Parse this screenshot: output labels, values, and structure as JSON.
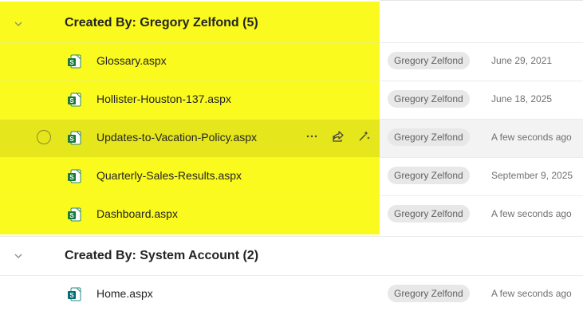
{
  "colors": {
    "highlight": "#fafa1e",
    "highlight_hover": "#e6e61c",
    "sharepoint_icon": "#036c70",
    "pill_bg": "#e8e8e8"
  },
  "groups": [
    {
      "title": "Created By: Gregory Zelfond (5)",
      "icon": "chevron-down-icon",
      "rows": [
        {
          "name": "Glossary.aspx",
          "modified_by": "Gregory Zelfond",
          "date": "June 29, 2021"
        },
        {
          "name": "Hollister-Houston-137.aspx",
          "modified_by": "Gregory Zelfond",
          "date": "June 18, 2025"
        },
        {
          "name": "Updates-to-Vacation-Policy.aspx",
          "modified_by": "Gregory Zelfond",
          "date": "A few seconds ago"
        },
        {
          "name": "Quarterly-Sales-Results.aspx",
          "modified_by": "Gregory Zelfond",
          "date": "September 9, 2025"
        },
        {
          "name": "Dashboard.aspx",
          "modified_by": "Gregory Zelfond",
          "date": "A few seconds ago"
        }
      ]
    },
    {
      "title": "Created By: System Account (2)",
      "icon": "chevron-down-icon",
      "rows": [
        {
          "name": "Home.aspx",
          "modified_by": "Gregory Zelfond",
          "date": "A few seconds ago"
        }
      ]
    }
  ],
  "row_actions": {
    "more": "more-options-icon",
    "share": "share-icon",
    "copilot": "copilot-sparkle-icon"
  }
}
